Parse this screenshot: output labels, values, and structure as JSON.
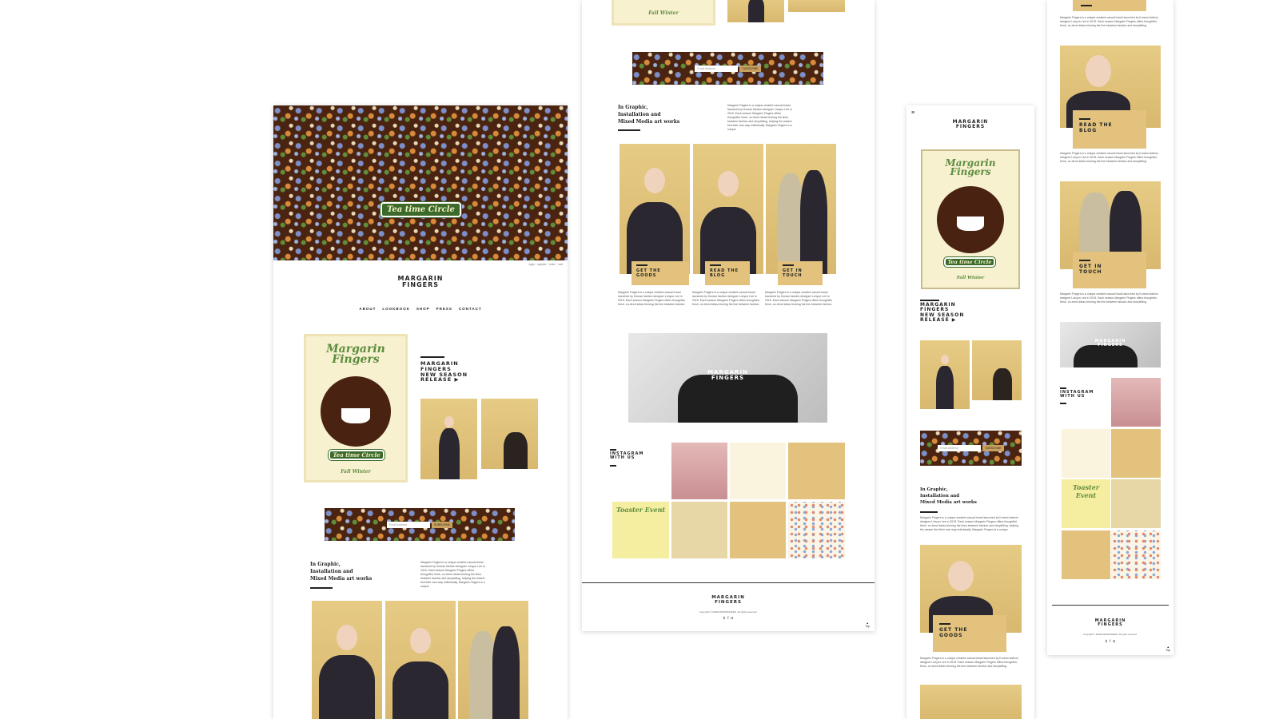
{
  "brand": {
    "logo_text": "MARGARIN\nFINGERS"
  },
  "hero": {
    "badge": "Tea time Circle"
  },
  "top_links": "login · register · order · cart",
  "nav": [
    "ABOUT",
    "LOOKBOOK",
    "SHOP",
    "PRESS",
    "CONTACT"
  ],
  "release": {
    "heading": "MARGARIN\nFINGERS\nNEW SEASON\nRELEASE ▶"
  },
  "poster": {
    "title": "Margarin\nFingers",
    "badge": "Tea time Circle",
    "footer": "Fall Winter"
  },
  "subscribe": {
    "placeholder": "Email Address",
    "button": "SUBSCRIBE"
  },
  "art": {
    "heading": "In Graphic,\nInstallation and\nMixed Media art works",
    "body": "Margarin Fingers is a unique creative casual brand launched by Korean fashion designer Lohyun Lee in 2015. Each season Margarin Fingers offers thoughtful, fresh, on-trend ideas blurring the lines between fashion and storytelling, helping the wearer find their own way individually. Margarin Fingers is a unique"
  },
  "ctas": {
    "goods": "GET THE\nGOODS",
    "blog": "READ THE\nBLOG",
    "touch": "GET IN\nTOUCH"
  },
  "cta_body": "Margarin Fingers is a unique creative casual brand launched by Korean fashion designer Lohyun Lee in 2015. Each season Margarin Fingers offers thoughtful, fresh, on-trend ideas blurring the line between fashion and storytelling.",
  "instagram": {
    "heading": "INSTAGRAM\nWITH US",
    "cover_text": "Toaster Event"
  },
  "footer": {
    "copyright": "Copyright © MARGARINFINGERS. All rights reserved.",
    "top": "Top",
    "social_icons": [
      "blog-icon",
      "facebook-icon",
      "instagram-icon"
    ]
  },
  "colors": {
    "brown": "#4a2410",
    "tan": "#e2c27d",
    "cream": "#f7f1cf",
    "green": "#5d8c3f"
  }
}
